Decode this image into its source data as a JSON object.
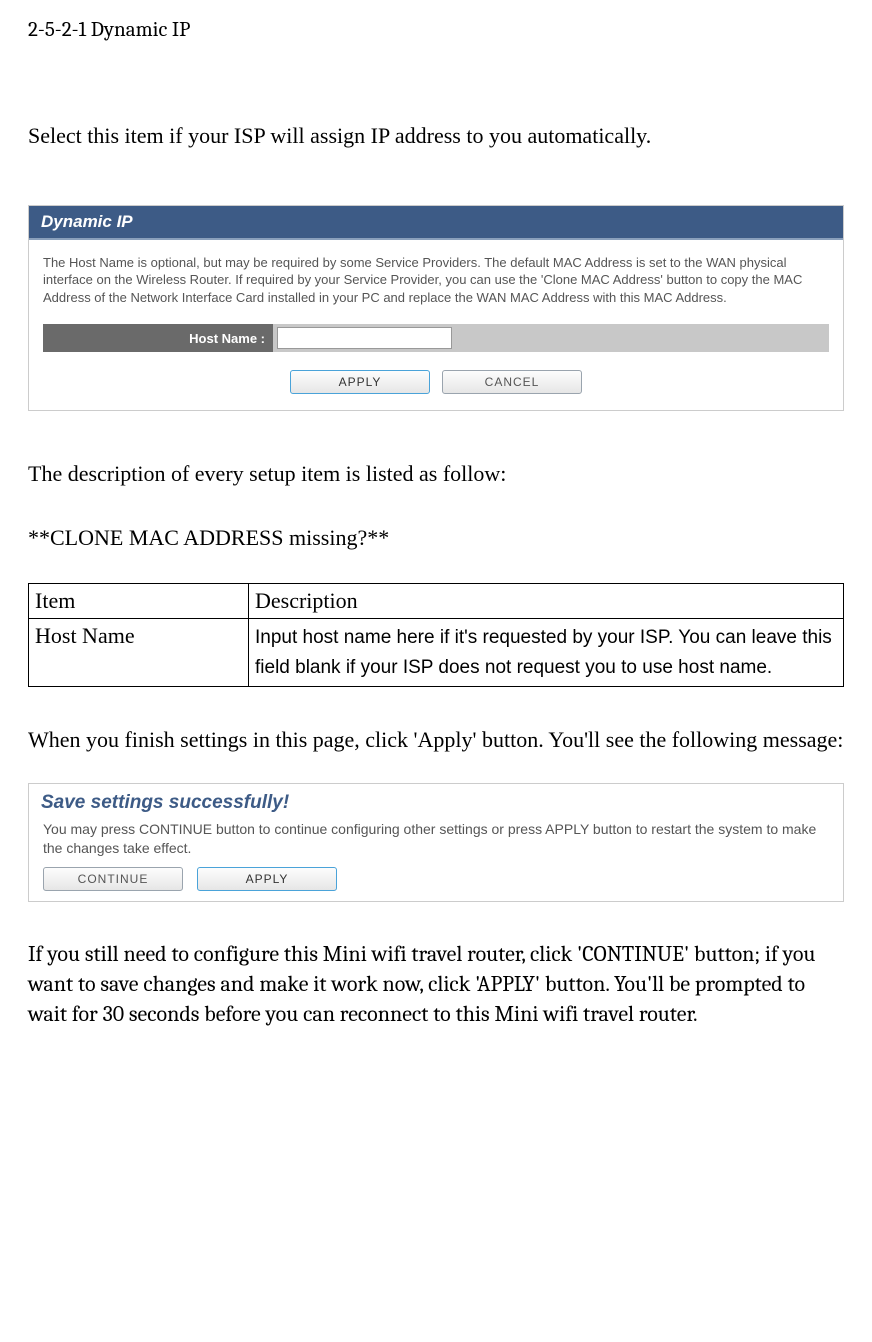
{
  "heading": "2-5-2-1 Dynamic IP",
  "intro": "Select this item if your ISP will assign IP address to you automatically.",
  "panel1": {
    "title": "Dynamic IP",
    "description": "The Host Name is optional, but may be required by some Service Providers. The default MAC Address is set to the WAN physical interface on the Wireless Router. If required by your Service Provider, you can use the 'Clone MAC Address' button to copy the MAC Address of the Network Interface Card installed in your PC and replace the WAN MAC Address with this MAC Address.",
    "field_label": "Host Name :",
    "field_value": "",
    "apply_btn": "APPLY",
    "cancel_btn": "CANCEL"
  },
  "desc_follows": "The description of every setup item is listed as follow:",
  "missing_note": "**CLONE MAC ADDRESS missing?**",
  "table": {
    "header_item": "Item",
    "header_desc": "Description",
    "rows": [
      {
        "item": "Host Name",
        "desc": "Input host name here if it's requested by your ISP. You can leave this field blank if your ISP does not request you to use host name."
      }
    ]
  },
  "after_apply": "When you finish settings in this page, click 'Apply' button. You'll see the following message:",
  "save_panel": {
    "title": "Save settings successfully!",
    "description": "You may press CONTINUE button to continue configuring other settings or press APPLY button to restart the system to make the changes take effect.",
    "continue_btn": "CONTINUE",
    "apply_btn": "APPLY"
  },
  "closing": "If you still need to configure this Mini wifi travel router, click 'CONTINUE' button; if you want to save changes and make it work now, click 'APPLY' button. You'll be prompted to wait for 30 seconds before you can reconnect to this Mini wifi travel router."
}
